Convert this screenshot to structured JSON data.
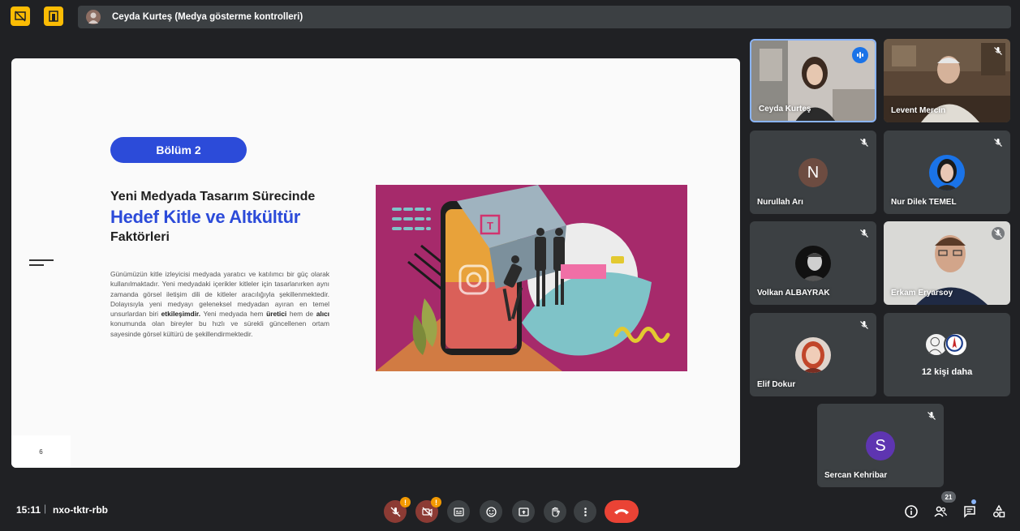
{
  "presenter_bar": {
    "label": "Ceyda Kurteş (Medya gösterme kontrolleri)"
  },
  "slide": {
    "chapter": "Bölüm 2",
    "title_line1": "Yeni Medyada Tasarım Sürecinde",
    "title_line2": "Hedef Kitle ve Altkültür",
    "title_line3": "Faktörleri",
    "body_part1": "Günümüzün kitle izleyicisi medyada yaratıcı ve katılımcı bir güç olarak kullanılmaktadır. Yeni medyadaki içerikler kitleler için tasarlanırken aynı zamanda görsel iletişim dili de kitleler aracılığıyla şekillenmektedir. Dolayısıyla yeni medyayı geleneksel medyadan ayıran en temel unsurlardan biri ",
    "body_bold1": "etkileşimdir.",
    "body_part2": " Yeni medyada hem ",
    "body_bold2": "üretici",
    "body_part3": " hem de ",
    "body_bold3": "alıcı",
    "body_part4": " konumunda olan bireyler bu hızlı ve sürekli güncellenen ortam sayesinde görsel kültürü de şekillendirmektedir.",
    "page_number": "6"
  },
  "participants": [
    {
      "name": "Ceyda Kurteş",
      "state": "speaking",
      "avatar": "video"
    },
    {
      "name": "Levent Mercin",
      "state": "muted",
      "avatar": "video"
    },
    {
      "name": "Nurullah Arı",
      "state": "muted",
      "avatar": "letter",
      "letter": "N",
      "color": "#6d4c41"
    },
    {
      "name": "Nur Dilek TEMEL",
      "state": "muted",
      "avatar": "photo"
    },
    {
      "name": "Volkan ALBAYRAK",
      "state": "muted",
      "avatar": "photo"
    },
    {
      "name": "Erkam Eryarsoy",
      "state": "muted",
      "avatar": "video"
    },
    {
      "name": "Elif Dokur",
      "state": "muted",
      "avatar": "photo"
    },
    {
      "name": "Sercan Kehribar",
      "state": "muted",
      "avatar": "letter",
      "letter": "S",
      "color": "#5e35b1"
    }
  ],
  "more_tile": {
    "label": "12 kişi daha"
  },
  "bottom_bar": {
    "time": "15:11",
    "separator": "|",
    "meeting_code": "nxo-tktr-rbb",
    "warn_badge": "!",
    "people_count": "21"
  },
  "colors": {
    "accent_blue": "#2c4bd9",
    "hangup_red": "#ea4335",
    "warning_yellow": "#fbbc04"
  }
}
